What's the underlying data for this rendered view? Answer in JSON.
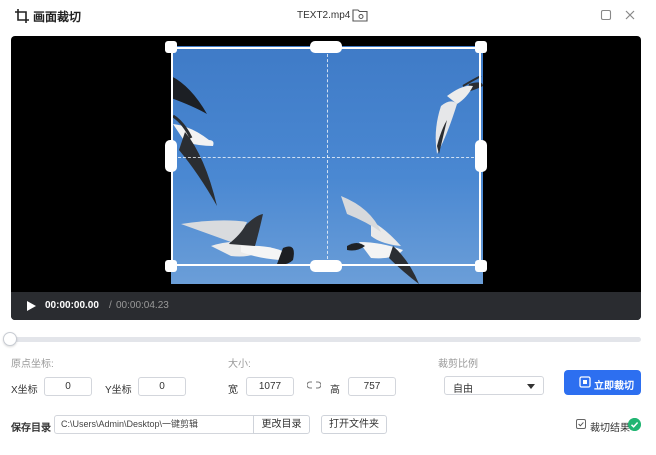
{
  "window": {
    "title": "画面裁切",
    "file_name": "TEXT2.mp4"
  },
  "player": {
    "current_time": "00:00:00.00",
    "separator": "/",
    "duration": "00:00:04.23"
  },
  "origin": {
    "section_label": "原点坐标:",
    "x_label": "X坐标",
    "x_value": "0",
    "y_label": "Y坐标",
    "y_value": "0"
  },
  "size": {
    "section_label": "大小:",
    "width_label": "宽",
    "width_value": "1077",
    "height_label": "高",
    "height_value": "757"
  },
  "ratio": {
    "section_label": "裁剪比例",
    "selected": "自由"
  },
  "actions": {
    "crop_now_label": "立即裁切",
    "save_dir_label": "保存目录",
    "save_path": "C:\\Users\\Admin\\Desktop\\一键剪辑",
    "change_dir_label": "更改目录",
    "open_folder_label": "打开文件夹",
    "crop_result_label": "裁切结果"
  },
  "colors": {
    "accent": "#2d6ff0",
    "success": "#22b573"
  }
}
